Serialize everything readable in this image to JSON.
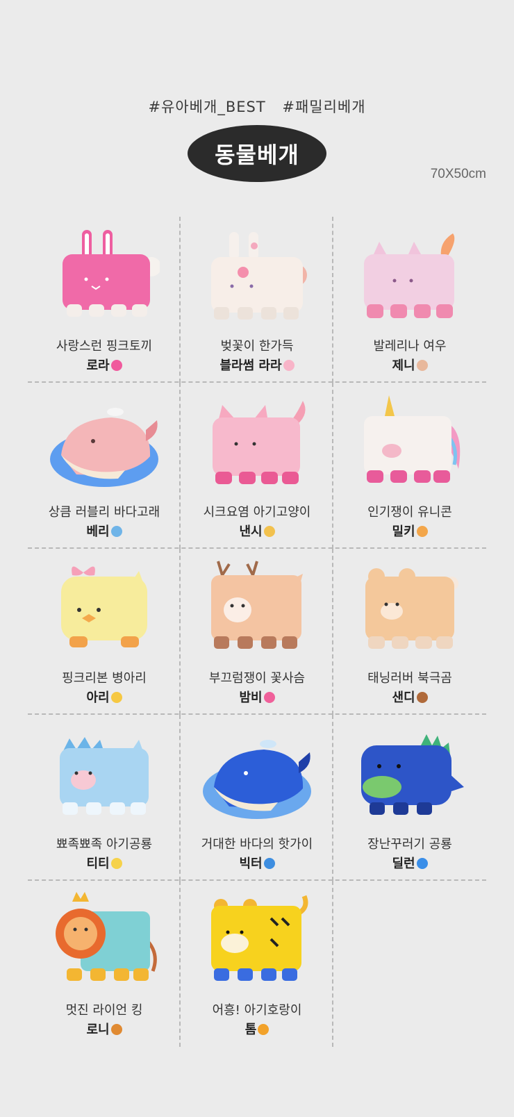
{
  "header": {
    "hashtag1": "#유아베개_BEST",
    "hashtag2": "#패밀리베개",
    "title": "동물베개",
    "size": "70X50cm"
  },
  "products": [
    {
      "desc": "사랑스런 핑크토끼",
      "name": "로라",
      "emoji": "💖",
      "color": "#f06aa8"
    },
    {
      "desc": "벚꽃이 한가득",
      "name": "블라썸 라라",
      "emoji": "🌸",
      "color": "#f7eee8"
    },
    {
      "desc": "발레리나 여우",
      "name": "제니",
      "emoji": "🩰",
      "color": "#f2cfe2"
    },
    {
      "desc": "상큼 러블리 바다고래",
      "name": "베리",
      "emoji": "🐳✨",
      "color": "#f4b6b8"
    },
    {
      "desc": "시크요염 아기고양이",
      "name": "낸시",
      "emoji": "😺",
      "color": "#f7b9cc"
    },
    {
      "desc": "인기쟁이 유니콘",
      "name": "밀키",
      "emoji": "🎉",
      "color": "#f6f1ee"
    },
    {
      "desc": "핑크리본 병아리",
      "name": "아리",
      "emoji": "🐤",
      "color": "#f7ec9c"
    },
    {
      "desc": "부끄럼쟁이 꽃사슴",
      "name": "밤비",
      "emoji": "💗😊",
      "color": "#f4c4a2"
    },
    {
      "desc": "태닝러버 북극곰",
      "name": "샌디",
      "emoji": "🧸",
      "color": "#f4c89b"
    },
    {
      "desc": "뾰족뾰족 아기공룡",
      "name": "티티",
      "emoji": "✨",
      "color": "#a9d5f2"
    },
    {
      "desc": "거대한 바다의 핫가이",
      "name": "빅터",
      "emoji": "🐳🌊",
      "color": "#2c5ed8"
    },
    {
      "desc": "장난꾸러기 공룡",
      "name": "딜런",
      "emoji": "💙",
      "color": "#2d55c8"
    },
    {
      "desc": "멋진 라이언 킹",
      "name": "로니",
      "emoji": "🦁",
      "color": "#7fd0d4"
    },
    {
      "desc": "어흥! 아기호랑이",
      "name": "톰",
      "emoji": "🐯",
      "color": "#f7d21e"
    }
  ]
}
